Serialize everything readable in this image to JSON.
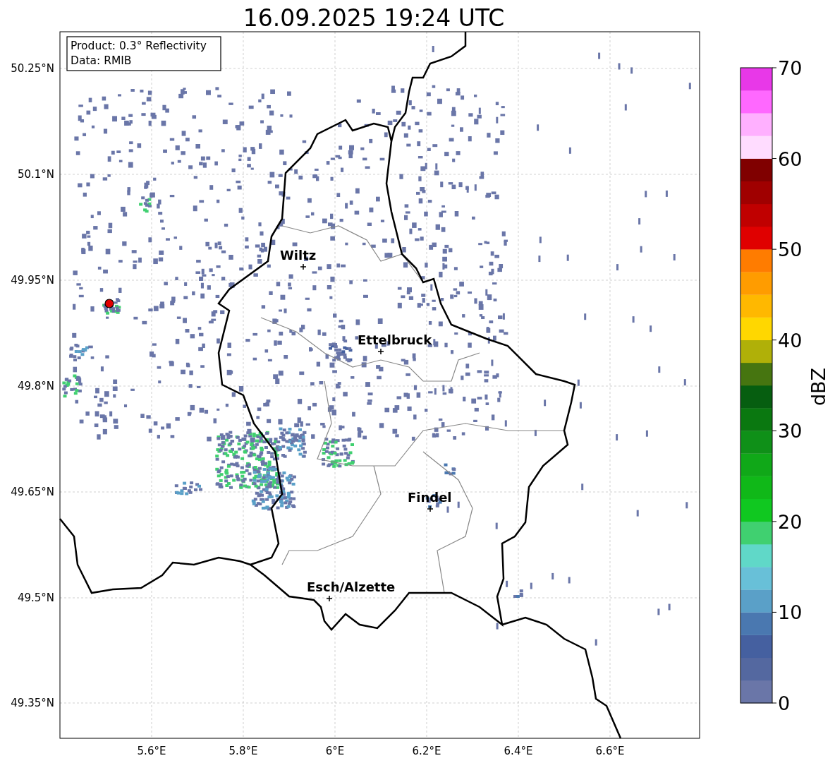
{
  "title": "16.09.2025 19:24 UTC",
  "info_box": [
    "Product: 0.3° Reflectivity",
    "Data: RMIB"
  ],
  "map": {
    "y_ticks": [
      "50.25°N",
      "50.1°N",
      "49.95°N",
      "49.8°N",
      "49.65°N",
      "49.5°N",
      "49.35°N"
    ],
    "x_ticks": [
      "5.6°E",
      "5.8°E",
      "6°E",
      "6.2°E",
      "6.4°E",
      "6.6°E"
    ],
    "cities": [
      {
        "name": "Wiltz"
      },
      {
        "name": "Ettelbruck"
      },
      {
        "name": "Findel"
      },
      {
        "name": "Esch/Alzette"
      }
    ]
  },
  "colorbar": {
    "label": "dBZ",
    "ticks": [
      "70",
      "60",
      "50",
      "40",
      "30",
      "20",
      "10",
      "0"
    ],
    "segments": [
      {
        "color": "#6a76a8"
      },
      {
        "color": "#5468a0"
      },
      {
        "color": "#4560a0"
      },
      {
        "color": "#4a78b0"
      },
      {
        "color": "#5aa0c8"
      },
      {
        "color": "#68c0d8"
      },
      {
        "color": "#60d8c8"
      },
      {
        "color": "#40d070"
      },
      {
        "color": "#10c820"
      },
      {
        "color": "#10b818"
      },
      {
        "color": "#10a818"
      },
      {
        "color": "#0f9018"
      },
      {
        "color": "#0a7810"
      },
      {
        "color": "#065e10"
      },
      {
        "color": "#467510"
      },
      {
        "color": "#b0b008"
      },
      {
        "color": "#ffd700"
      },
      {
        "color": "#ffb800"
      },
      {
        "color": "#ff9c00"
      },
      {
        "color": "#ff7c00"
      },
      {
        "color": "#e00000"
      },
      {
        "color": "#c00000"
      },
      {
        "color": "#a00000"
      },
      {
        "color": "#800000"
      },
      {
        "color": "#ffdcff"
      },
      {
        "color": "#ffb0ff"
      },
      {
        "color": "#ff68ff"
      },
      {
        "color": "#e838e8"
      }
    ]
  }
}
